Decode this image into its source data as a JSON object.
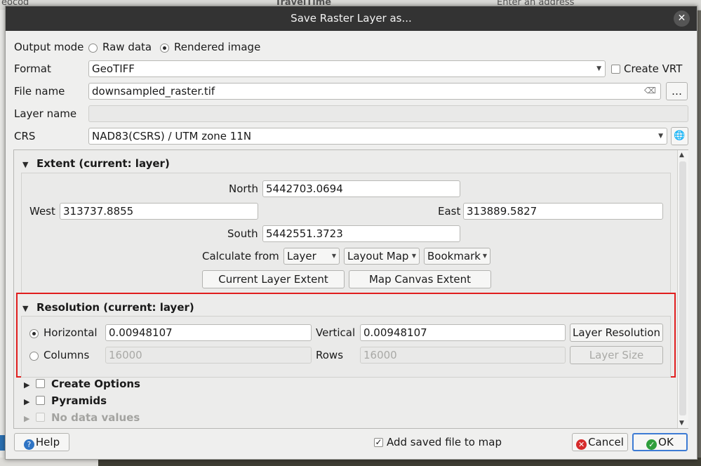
{
  "window": {
    "title": "Save Raster Layer as..."
  },
  "background": {
    "left_text": "eocod",
    "addr_text": "Enter an address",
    "app_text": "TravelTime"
  },
  "output_mode": {
    "label": "Output mode",
    "options": [
      {
        "label": "Raw data",
        "checked": false
      },
      {
        "label": "Rendered image",
        "checked": true
      }
    ]
  },
  "format": {
    "label": "Format",
    "value": "GeoTIFF",
    "create_vrt_label": "Create VRT",
    "create_vrt_checked": false
  },
  "file_name": {
    "label": "File name",
    "value": "downsampled_raster.tif",
    "browse_label": "…"
  },
  "layer_name": {
    "label": "Layer name",
    "value": ""
  },
  "crs": {
    "label": "CRS",
    "value": "NAD83(CSRS) / UTM zone 11N"
  },
  "extent": {
    "title": "Extent (current: layer)",
    "north_label": "North",
    "north": "5442703.0694",
    "west_label": "West",
    "west": "313737.8855",
    "east_label": "East",
    "east": "313889.5827",
    "south_label": "South",
    "south": "5442551.3723",
    "calculate_from_label": "Calculate from",
    "calc_buttons": [
      "Layer",
      "Layout Map",
      "Bookmark"
    ],
    "current_layer_extent": "Current Layer Extent",
    "map_canvas_extent": "Map Canvas Extent"
  },
  "resolution": {
    "title": "Resolution (current: layer)",
    "horizontal_label": "Horizontal",
    "horizontal": "0.00948107",
    "vertical_label": "Vertical",
    "vertical": "0.00948107",
    "layer_resolution_button": "Layer Resolution",
    "columns_label": "Columns",
    "columns": "16000",
    "rows_label": "Rows",
    "rows": "16000",
    "layer_size_button": "Layer Size"
  },
  "sections": {
    "create_options": "Create Options",
    "pyramids": "Pyramids",
    "no_data_values": "No data values"
  },
  "footer": {
    "help": "Help",
    "add_saved_label": "Add saved file to map",
    "add_saved_checked": true,
    "cancel": "Cancel",
    "ok": "OK"
  },
  "colors": {
    "highlight": "#e01e1e",
    "titlebar": "#333333",
    "ok_border": "#3d7bd4"
  }
}
